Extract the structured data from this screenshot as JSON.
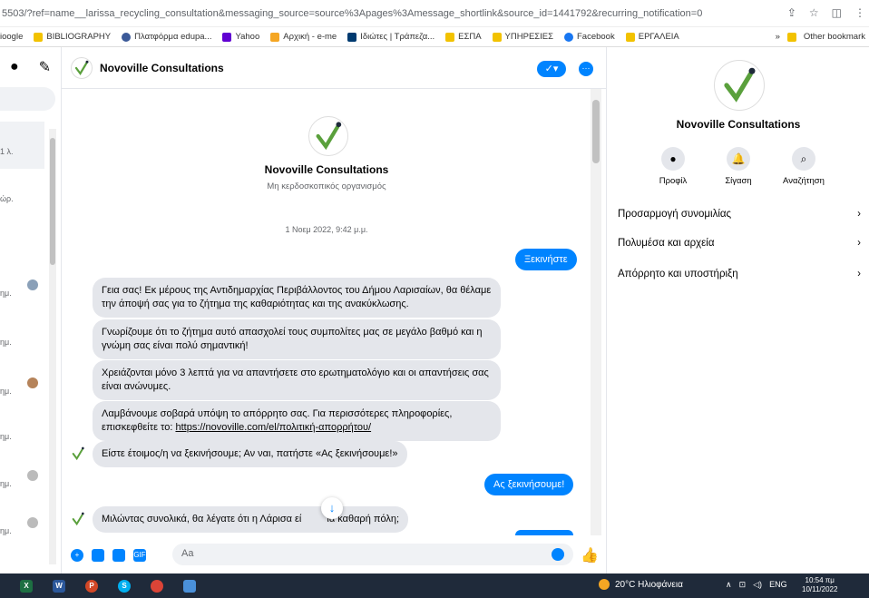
{
  "browser": {
    "url": "5503/?ref=name__larissa_recycling_consultation&messaging_source=source%3Apages%3Amessage_shortlink&source_id=1441792&recurring_notification=0",
    "bookmarks": [
      "ioogle",
      "BIBLIOGRAPHY",
      "Πλατφόρμα edupa...",
      "Yahoo",
      "Αρχική - e-me",
      "Ιδιώτες | Τράπεζα...",
      "ΕΣΠΑ",
      "ΥΠΗΡΕΣΙΕΣ",
      "Facebook",
      "ΕΡΓΑΛΕΙΑ"
    ],
    "other_bookmarks": "Other bookmark",
    "chevron": "»"
  },
  "leftrail": {
    "times": [
      "1 λ.",
      "ώρ.",
      "ημ.",
      "ημ.",
      "ημ.",
      "ημ.",
      "ημ.",
      "ημ."
    ]
  },
  "chat": {
    "header_name": "Novoville Consultations",
    "profile_name": "Novoville Consultations",
    "profile_subtitle": "Μη κερδοσκοπικός οργανισμός",
    "date": "1 Νοεμ 2022, 9:42 μ.μ.",
    "start_button": "Ξεκινήστε",
    "messages": [
      "Γεια σας! Εκ μέρους της Αντιδημαρχίας Περιβάλλοντος του Δήμου Λαρισαίων, θα θέλαμε την άποψή σας για το ζήτημα της καθαριότητας και της ανακύκλωσης.",
      "Γνωρίζουμε ότι το ζήτημα αυτό απασχολεί τους συμπολίτες μας σε μεγάλο βαθμό και η γνώμη σας είναι πολύ σημαντική!",
      "Χρειάζονται μόνο 3 λεπτά για να απαντήσετε στο ερωτηματολόγιο και οι απαντήσεις σας είναι ανώνυμες.",
      "Λαμβάνουμε σοβαρά υπόψη το απόρρητο σας. Για περισσότερες πληροφορίες, επισκεφθείτε το:",
      "Είστε έτοιμος/η να ξεκινήσουμε; Αν ναι, πατήστε «Ας ξεκινήσουμε!»"
    ],
    "privacy_link": "https://novoville.com/el/πολιτική-απορρήτου/",
    "reply_button": "Ας ξεκινήσουμε!",
    "question": "Μιλώντας συνολικά, θα λέγατε ότι η Λάρισα εί",
    "question_end": "ια καθαρή πόλη;",
    "composer_placeholder": "Aa"
  },
  "rightpanel": {
    "name": "Novoville Consultations",
    "actions": [
      "Προφίλ",
      "Σίγαση",
      "Αναζήτηση"
    ],
    "rows": [
      "Προσαρμογή συνομιλίας",
      "Πολυμέσα και αρχεία",
      "Απόρρητο και υποστήριξη"
    ],
    "chevron": "›"
  },
  "taskbar": {
    "weather": "20°C Ηλιοφάνεια",
    "lang": "ENG",
    "time": "10:54 πμ",
    "date": "10/11/2022",
    "app_letters": [
      "X",
      "W",
      "P",
      "S",
      "",
      ""
    ]
  },
  "colors": {
    "accent": "#0084ff",
    "bubble": "#e4e6eb",
    "taskbar": "#1f2a3a",
    "brand_green": "#5aa03c"
  }
}
